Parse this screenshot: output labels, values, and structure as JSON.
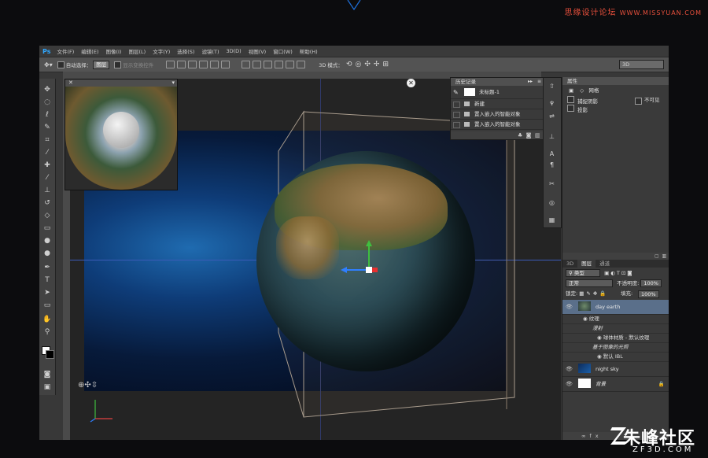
{
  "watermark_top": {
    "text": "思缘设计论坛",
    "url": "WWW.MISSYUAN.COM"
  },
  "watermark_bottom": {
    "cn": "朱峰社区",
    "en": "ZF3D.COM"
  },
  "app": {
    "logo": "Ps"
  },
  "menu": [
    "文件(F)",
    "编辑(E)",
    "图像(I)",
    "图层(L)",
    "文字(Y)",
    "选择(S)",
    "滤镜(T)",
    "3D(D)",
    "视图(V)",
    "窗口(W)",
    "帮助(H)"
  ],
  "options": {
    "auto_select_label": "自动选择：",
    "auto_select_value": "图层",
    "show_transform_label": "显示变换控件",
    "mode_label": "3D 模式：",
    "workspace": "3D"
  },
  "history": {
    "title": "历史记录",
    "doc_name": "未标题-1",
    "items": [
      "新建",
      "置入嵌入的智能对象",
      "置入嵌入的智能对象"
    ]
  },
  "properties": {
    "title": "属性",
    "mesh_label": "网格",
    "cast_shadow": "捕捉阴影",
    "invisible": "不可见",
    "shadow": "投影"
  },
  "layers": {
    "tabs": [
      "3D",
      "图层",
      "通道"
    ],
    "kind_label": "类型",
    "blend_mode": "正常",
    "opacity_label": "不透明度:",
    "opacity_value": "100%",
    "lock_label": "锁定:",
    "fill_label": "填充:",
    "fill_value": "100%",
    "items": [
      {
        "name": "day earth",
        "selected": true
      },
      {
        "name": "night sky",
        "selected": false
      },
      {
        "name": "背景",
        "selected": false
      }
    ],
    "sub_items": [
      "纹理",
      "漫射",
      "球体材质 - 默认纹理",
      "基于图像的光照",
      "默认 IBL"
    ]
  }
}
